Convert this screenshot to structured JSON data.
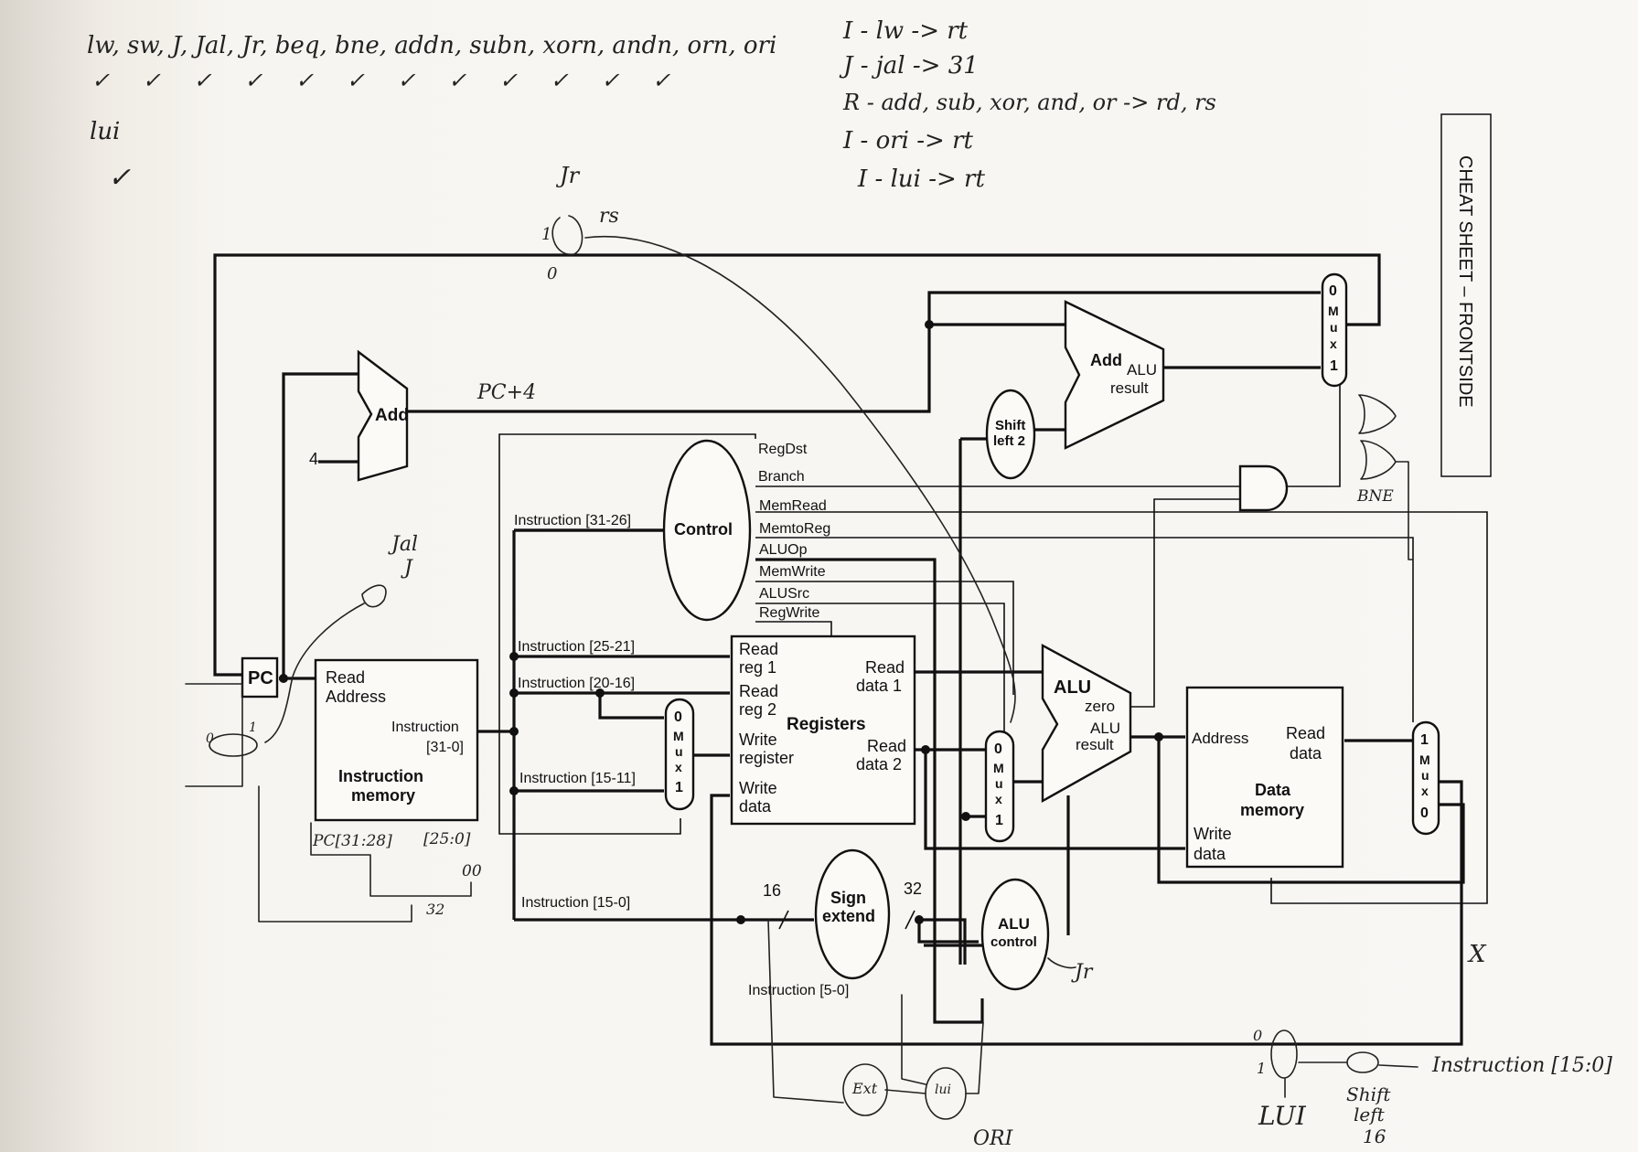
{
  "notes": {
    "instr_list": "lw, sw, J, Jal, Jr, beq, bne, addn, subn, xorn, andn, orn, ori",
    "checks": "✓ ✓ ✓ ✓ ✓ ✓ ✓ ✓ ✓ ✓ ✓ ✓",
    "lui": "lui",
    "lui_check": "✓",
    "rules": [
      "I - lw -> rt",
      "J - jal -> 31",
      "R - add, sub, xor, and, or -> rd, rs",
      "I - ori -> rt",
      "I - lui -> rt"
    ]
  },
  "cheat_sheet": "CHEAT SHEET – FRONTSIDE",
  "blocks": {
    "pc": "PC",
    "add_pc": "Add",
    "four": "4",
    "pc_plus4": "PC+4",
    "imem_read": "Read",
    "imem_address": "Address",
    "imem_instr": "Instruction",
    "imem_bits": "[31-0]",
    "imem_title1": "Instruction",
    "imem_title2": "memory",
    "control": "Control",
    "shift_left2_a": "Shift",
    "shift_left2_b": "left 2",
    "add_alu_add": "Add",
    "add_alu_alu": "ALU",
    "add_alu_result": "result",
    "registers": "Registers",
    "read_reg1_a": "Read",
    "read_reg1_b": "reg 1",
    "read_reg2_a": "Read",
    "read_reg2_b": "reg 2",
    "write_reg_a": "Write",
    "write_reg_b": "register",
    "write_data_a": "Write",
    "write_data_b": "data",
    "read_data1_a": "Read",
    "read_data1_b": "data 1",
    "read_data2_a": "Read",
    "read_data2_b": "data 2",
    "alu": "ALU",
    "alu_zero": "zero",
    "alu_result_a": "ALU",
    "alu_result_b": "result",
    "dmem_address": "Address",
    "dmem_read_a": "Read",
    "dmem_read_b": "data",
    "dmem_title1": "Data",
    "dmem_title2": "memory",
    "dmem_write_a": "Write",
    "dmem_write_b": "data",
    "sign_extend_a": "Sign",
    "sign_extend_b": "extend",
    "alu_control_a": "ALU",
    "alu_control_b": "control",
    "bits16": "16",
    "bits32": "32"
  },
  "signals": {
    "regdst": "RegDst",
    "branch": "Branch",
    "memread": "MemRead",
    "memtoreg": "MemtoReg",
    "aluop": "ALUOp",
    "memwrite": "MemWrite",
    "alusrc": "ALUSrc",
    "regwrite": "RegWrite"
  },
  "instr_fields": {
    "f31_26": "Instruction [31-26]",
    "f25_21": "Instruction [25-21]",
    "f20_16": "Instruction [20-16]",
    "f15_11": "Instruction [15-11]",
    "f15_0": "Instruction [15-0]",
    "f5_0": "Instruction [5-0]"
  },
  "mux": {
    "top_0": "0",
    "top_m": "M",
    "top_u": "u",
    "top_x": "x",
    "top_1": "1",
    "reg_0": "0",
    "reg_m": "M",
    "reg_u": "u",
    "reg_x": "x",
    "reg_1": "1",
    "alu_0": "0",
    "alu_m": "M",
    "alu_u": "u",
    "alu_x": "x",
    "alu_1": "1",
    "mem_1": "1",
    "mem_m": "M",
    "mem_u": "u",
    "mem_x": "x",
    "mem_0": "0"
  },
  "hand_annotations": {
    "jr_j": "Jr",
    "rs": "rs",
    "one": "1",
    "zero": "0",
    "jal": "Jal",
    "j": "J",
    "pc_31_28": "PC[31:28]",
    "bits_25_0": "[25:0]",
    "zero_zero": "00",
    "n32": "32",
    "mux_one": "1",
    "mux_zero": "0",
    "bne": "BNE",
    "jr": "Jr",
    "x_mark": "X",
    "ext": "Ext",
    "lui_mux": "lui",
    "or_label": "ORI",
    "mux_lui_0": "0",
    "mux_lui_1": "1",
    "lui_label": "LUI",
    "shift_left16_a": "Shift",
    "shift_left16_b": "left",
    "shift_left16_c": "16",
    "instr_15_0": "Instruction [15:0]"
  }
}
